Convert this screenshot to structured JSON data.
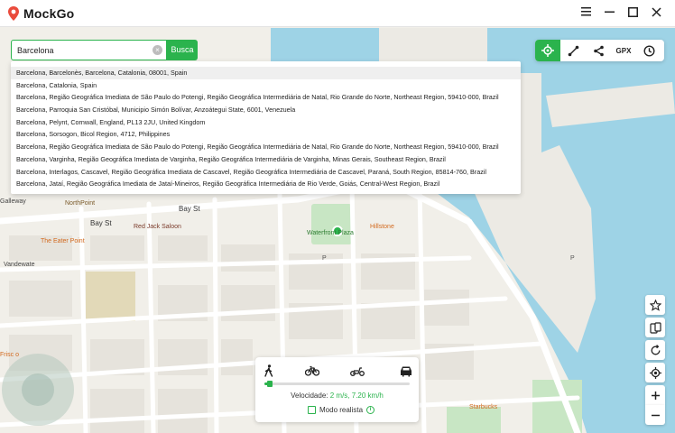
{
  "app": {
    "name": "MockGo"
  },
  "search": {
    "value": "Barcelona",
    "button_label": "Busca"
  },
  "suggestions": [
    "Barcelona, Barcelonès, Barcelona, Catalonia, 08001, Spain",
    "Barcelona, Catalonia, Spain",
    "Barcelona, Região Geográfica Imediata de São Paulo do Potengi, Região Geográfica Intermediária de Natal, Rio Grande do Norte, Northeast Region, 59410-000, Brazil",
    "Barcelona, Parroquia San Cristóbal, Municipio Simón Bolívar, Anzoátegui State, 6001, Venezuela",
    "Barcelona, Pelynt, Cornwall, England, PL13 2JU, United Kingdom",
    "Barcelona, Sorsogon, Bicol Region, 4712, Philippines",
    "Barcelona, Região Geográfica Imediata de São Paulo do Potengi, Região Geográfica Intermediária de Natal, Rio Grande do Norte, Northeast Region, 59410-000, Brazil",
    "Barcelona, Varginha, Região Geográfica Imediata de Varginha, Região Geográfica Intermediária de Varginha, Minas Gerais, Southeast Region, Brazil",
    "Barcelona, Interlagos, Cascavel, Região Geográfica Imediata de Cascavel, Região Geográfica Intermediária de Cascavel, Paraná, South Region, 85814-760, Brazil",
    "Barcelona, Jataí, Região Geográfica Imediata de Jataí-Mineiros, Região Geográfica Intermediária de Rio Verde, Goiás, Central-West Region, Brazil"
  ],
  "toolbar": {
    "gpx_label": "GPX"
  },
  "speed": {
    "label": "Velocidade:",
    "value": "2 m/s, 7.20 km/h",
    "realistic_label": "Modo realista",
    "slider_fraction": 0.04
  },
  "map_labels": {
    "bay_st": "Bay St",
    "northpoint": "NorthPoint",
    "red_jack": "Red Jack Saloon",
    "eater_point": "The Eater Point",
    "vandewate": "Vandewate",
    "waterfront": "Waterfront Plaza",
    "hillstone": "Hillstone",
    "starbucks": "Starbucks",
    "parking": "P",
    "galleway": "Galleway",
    "friscolo": "Frisc o"
  },
  "colors": {
    "accent": "#2bb34d",
    "water": "#9ed3e6",
    "land": "#f1efe9",
    "park": "#c8e6c4"
  }
}
